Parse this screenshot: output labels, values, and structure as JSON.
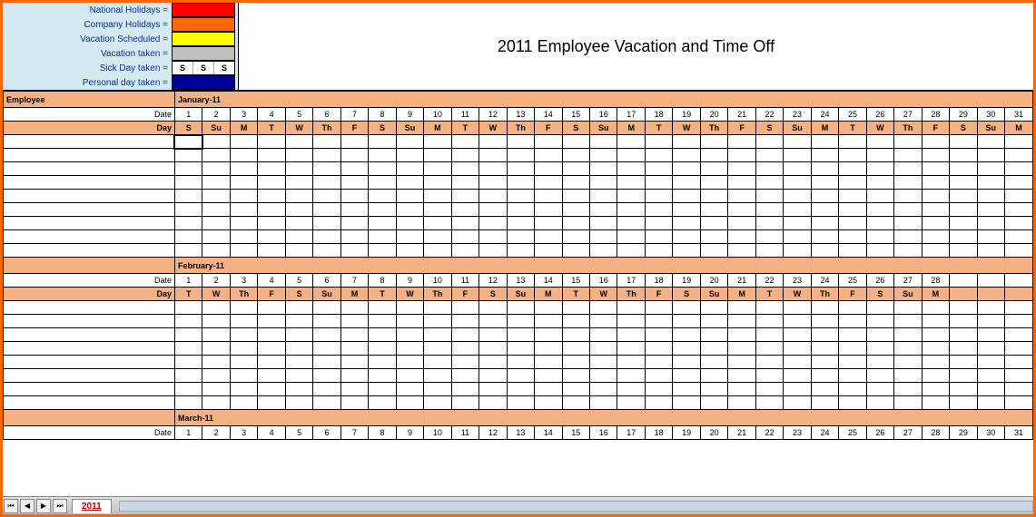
{
  "title": "2011 Employee Vacation and Time Off",
  "legend": {
    "national": {
      "label": "National Holidays =",
      "color": "#ff0000"
    },
    "company": {
      "label": "Company Holidays =",
      "color": "#ff6600"
    },
    "vac_sched": {
      "label": "Vacation Scheduled =",
      "color": "#ffff00"
    },
    "vac_taken": {
      "label": "Vacation taken =",
      "color": "#bfbfbf"
    },
    "sick": {
      "label": "Sick Day taken =",
      "cell_text": "S",
      "cell_bg": "#ffffff"
    },
    "personal": {
      "label": "Personal day taken =",
      "color": "#000099"
    }
  },
  "columns": {
    "employee": "Employee",
    "date": "Date",
    "day": "Day"
  },
  "months": {
    "jan": {
      "name": "January-11",
      "dates": [
        1,
        2,
        3,
        4,
        5,
        6,
        7,
        8,
        9,
        10,
        11,
        12,
        13,
        14,
        15,
        16,
        17,
        18,
        19,
        20,
        21,
        22,
        23,
        24,
        25,
        26,
        27,
        28,
        29,
        30,
        31
      ],
      "days": [
        "S",
        "Su",
        "M",
        "T",
        "W",
        "Th",
        "F",
        "S",
        "Su",
        "M",
        "T",
        "W",
        "Th",
        "F",
        "S",
        "Su",
        "M",
        "T",
        "W",
        "Th",
        "F",
        "S",
        "Su",
        "M",
        "T",
        "W",
        "Th",
        "F",
        "S",
        "Su",
        "M"
      ]
    },
    "feb": {
      "name": "February-11",
      "dates": [
        1,
        2,
        3,
        4,
        5,
        6,
        7,
        8,
        9,
        10,
        11,
        12,
        13,
        14,
        15,
        16,
        17,
        18,
        19,
        20,
        21,
        22,
        23,
        24,
        25,
        26,
        27,
        28
      ],
      "days": [
        "T",
        "W",
        "Th",
        "F",
        "S",
        "Su",
        "M",
        "T",
        "W",
        "Th",
        "F",
        "S",
        "Su",
        "M",
        "T",
        "W",
        "Th",
        "F",
        "S",
        "Su",
        "M",
        "T",
        "W",
        "Th",
        "F",
        "S",
        "Su",
        "M"
      ]
    },
    "mar": {
      "name": "March-11",
      "dates": [
        1,
        2,
        3,
        4,
        5,
        6,
        7,
        8,
        9,
        10,
        11,
        12,
        13,
        14,
        15,
        16,
        17,
        18,
        19,
        20,
        21,
        22,
        23,
        24,
        25,
        26,
        27,
        28,
        29,
        30,
        31
      ]
    }
  },
  "sheet_tab": "2011"
}
